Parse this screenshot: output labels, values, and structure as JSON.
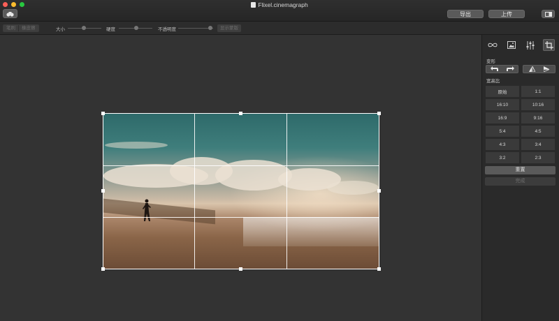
{
  "window": {
    "title": "Flixel.cinemagraph",
    "export_label": "导出",
    "share_label": "上传"
  },
  "toolbar": {
    "mode_left": "笔刷",
    "mode_right": "橡皮擦",
    "size_label": "大小",
    "hardness_label": "硬度",
    "opacity_label": "不透明度",
    "disabled_action": "显示蒙版"
  },
  "panel": {
    "tabs": [
      {
        "name": "loop-tab",
        "icon": "infinity-icon"
      },
      {
        "name": "image-tab",
        "icon": "image-icon"
      },
      {
        "name": "adjust-tab",
        "icon": "sliders-icon"
      },
      {
        "name": "crop-tab",
        "icon": "crop-icon",
        "active": true
      }
    ],
    "transform_title": "变形",
    "aspect_title": "宽高比",
    "ratios": [
      "原始",
      "1:1",
      "16:10",
      "10:16",
      "16:9",
      "9:16",
      "5:4",
      "4:5",
      "4:3",
      "3:4",
      "3:2",
      "2:3"
    ],
    "reset_label": "重置",
    "done_label": "完成"
  },
  "colors": {
    "background": "#323232",
    "panel": "#2a2a2a",
    "button": "#5a5a5a",
    "close": "#fc5f57",
    "minimize": "#fdbc2e",
    "maximize": "#28c840"
  }
}
